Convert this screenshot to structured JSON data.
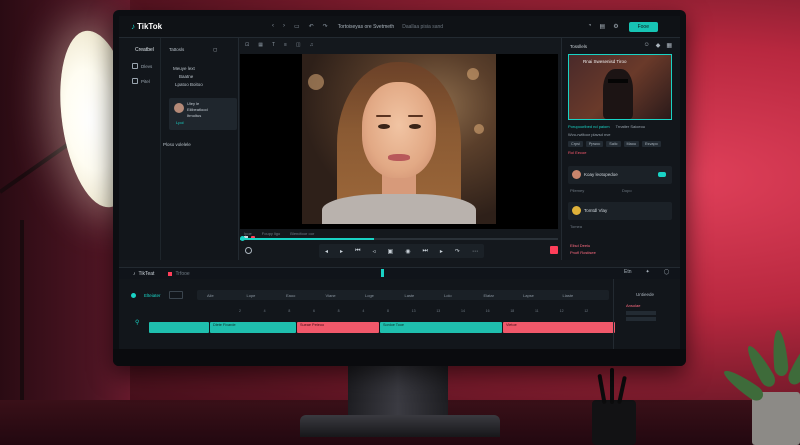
{
  "app": {
    "logo": "TikTok",
    "filename": "Tortoiseyas ore Svetmeth",
    "status": "Daallaa pisia sand",
    "export_label": "Fooe"
  },
  "left_panel": {
    "heading": "Creatbel",
    "tab_right": "Tattosls",
    "items": [
      {
        "label": "Dlevs"
      },
      {
        "label": "Pitel"
      }
    ],
    "right_labels": [
      "Meuye lext",
      "Baatne",
      "Lpatoo Boitoo"
    ],
    "card": {
      "lines": [
        "Uley le",
        "Eilibeatlood",
        "Itrnoltus"
      ],
      "tag": "Lpol"
    },
    "footer": "Ploso volelele"
  },
  "preview": {
    "time_labels": [
      "Ipoe",
      "Foupy ligo",
      "Blendtoor oor"
    ]
  },
  "right_panel": {
    "header": "Tossllels",
    "thumb_title": "Rnai Swesenisd Tiroo",
    "line1": "Porupoorlbed nd paiom",
    "line1b": "Trnatler Saioeou",
    "line2": "Wvo-rwiltoor plavsd nve",
    "line3": "Rol Eecoe",
    "chips": [
      "Crpsi",
      "Ppwoc",
      "Saiic",
      "Maou",
      "Esvapo"
    ],
    "card1": "Koay leotopedoe",
    "card1_sub": "Pllemey",
    "card1_sub2": "Dopo",
    "card2": "Tomtdl Vlay",
    "card2_sub": "Tomea",
    "footer1": "Elisd Deeiu",
    "footer2": "Pnofl Rostisee"
  },
  "timeline": {
    "tab": "TikTeat",
    "tab2": "Trfooe",
    "right_label": "Etn",
    "left_label": "Elteiater",
    "ruler_labels": [
      "Aile",
      "Lope",
      "Eaoo",
      "Viane",
      "Loge",
      "Laste",
      "Lolo",
      "Elatar",
      "Lapse",
      "Llaste"
    ],
    "ticks": [
      "2",
      "4",
      "8",
      "6",
      "8",
      "4",
      "8",
      "13",
      "13",
      "14",
      "16",
      "18",
      "11",
      "12",
      "12"
    ],
    "clips": [
      {
        "label": "",
        "color": "teal"
      },
      {
        "label": "Dlete Fivarde",
        "color": "teal"
      },
      {
        "label": "Sueae Peteoo",
        "color": "red"
      },
      {
        "label": "Sonloe Tooe",
        "color": "teal"
      },
      {
        "label": "Vietoe",
        "color": "red"
      }
    ],
    "right_col_label": "Untieede",
    "right_col_red": "Ansolae"
  }
}
